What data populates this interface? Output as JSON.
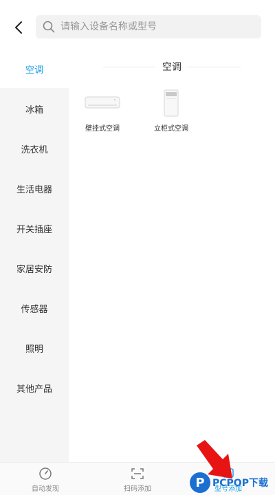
{
  "search": {
    "placeholder": "请输入设备名称或型号"
  },
  "sidebar": {
    "items": [
      {
        "label": "空调"
      },
      {
        "label": "冰箱"
      },
      {
        "label": "洗衣机"
      },
      {
        "label": "生活电器"
      },
      {
        "label": "开关插座"
      },
      {
        "label": "家居安防"
      },
      {
        "label": "传感器"
      },
      {
        "label": "照明"
      },
      {
        "label": "其他产品"
      }
    ]
  },
  "section": {
    "title": "空调"
  },
  "products": [
    {
      "name": "壁挂式空调"
    },
    {
      "name": "立柜式空调"
    }
  ],
  "tabs": [
    {
      "label": "自动发现"
    },
    {
      "label": "扫码添加"
    },
    {
      "label": "型号添加"
    }
  ],
  "watermark": {
    "logo_letter": "P",
    "text": "PCPOP下载"
  },
  "colors": {
    "accent": "#1aa0e8",
    "arrow": "#e81414",
    "watermark": "#1a6fd1"
  },
  "icons": {
    "back": "chevron-left-icon",
    "search": "search-icon",
    "auto_discover": "compass-icon",
    "scan": "scan-icon",
    "model": "model-icon"
  }
}
